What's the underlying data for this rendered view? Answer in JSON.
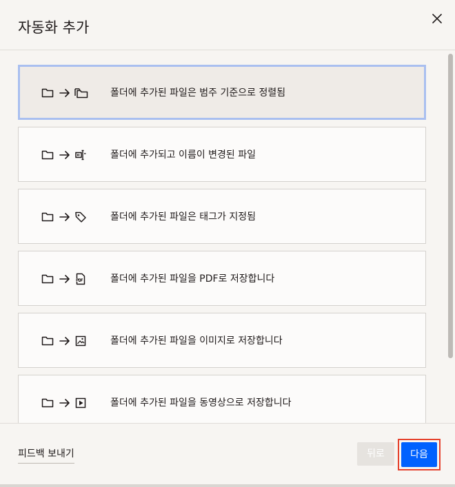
{
  "dialog": {
    "title": "자동화 추가",
    "close_icon": "close-icon"
  },
  "options": [
    {
      "label": "폴더에 추가된 파일은 범주 기준으로 정렬됨",
      "icon": "folder-sort-icon",
      "selected": true
    },
    {
      "label": "폴더에 추가되고 이름이 변경된 파일",
      "icon": "rename-icon",
      "selected": false
    },
    {
      "label": "폴더에 추가된 파일은 태그가 지정됨",
      "icon": "tag-icon",
      "selected": false
    },
    {
      "label": "폴더에 추가된 파일을 PDF로 저장합니다",
      "icon": "pdf-file-icon",
      "selected": false
    },
    {
      "label": "폴더에 추가된 파일을 이미지로 저장합니다",
      "icon": "image-file-icon",
      "selected": false
    },
    {
      "label": "폴더에 추가된 파일을 동영상으로 저장합니다",
      "icon": "video-file-icon",
      "selected": false
    }
  ],
  "footer": {
    "feedback_label": "피드백 보내기",
    "back_label": "뒤로",
    "next_label": "다음"
  },
  "colors": {
    "primary": "#0061fe",
    "selected_border": "#a9bff0",
    "highlight_outline": "#e5412c",
    "disabled_button": "#e6e3df"
  }
}
